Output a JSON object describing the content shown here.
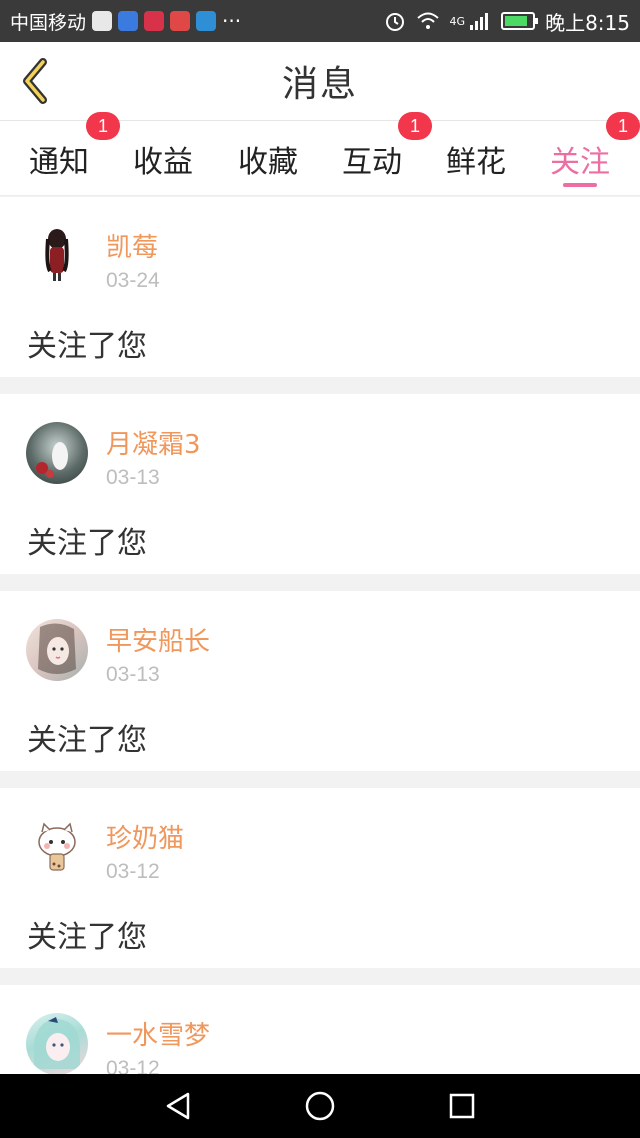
{
  "status_bar": {
    "carrier": "中国移动",
    "more": "···",
    "network": "4G",
    "time": "晚上8:15"
  },
  "header": {
    "title": "消息",
    "back_icon": "chevron-left-icon"
  },
  "tabs": [
    {
      "label": "通知",
      "badge": "1"
    },
    {
      "label": "收益",
      "badge": ""
    },
    {
      "label": "收藏",
      "badge": ""
    },
    {
      "label": "互动",
      "badge": "1"
    },
    {
      "label": "鲜花",
      "badge": ""
    },
    {
      "label": "关注",
      "badge": "1",
      "active": true
    }
  ],
  "colors": {
    "accent": "#ec6ea3",
    "name": "#f0975c",
    "badge": "#f2364b"
  },
  "messages": [
    {
      "name": "凯莓",
      "date": "03-24",
      "text": "关注了您"
    },
    {
      "name": "月凝霜3",
      "date": "03-13",
      "text": "关注了您"
    },
    {
      "name": "早安船长",
      "date": "03-13",
      "text": "关注了您"
    },
    {
      "name": "珍奶猫",
      "date": "03-12",
      "text": "关注了您"
    },
    {
      "name": "一水雪梦",
      "date": "03-12",
      "text": ""
    }
  ],
  "nav": {
    "back": "back-triangle-icon",
    "home": "home-circle-icon",
    "recents": "recents-square-icon"
  }
}
